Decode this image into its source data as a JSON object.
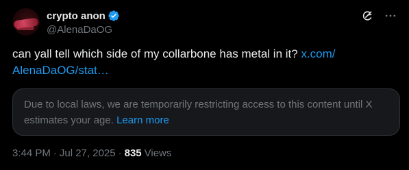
{
  "author": {
    "display_name": "crypto anon",
    "handle": "@AlenaDaOG",
    "verified": true
  },
  "post": {
    "text": "can yall tell which side of my collarbone has metal in it? ",
    "link_line1": "x.com/",
    "link_line2": "AlenaDaOG/stat…"
  },
  "notice": {
    "text": "Due to local laws, we are temporarily restricting access to this content until X estimates your age. ",
    "link": "Learn more"
  },
  "meta": {
    "time": "3:44 PM",
    "separator": "·",
    "date": "Jul 27, 2025",
    "views_count": "835",
    "views_label": "Views"
  },
  "icons": {
    "verified": "verified-badge-icon",
    "grok": "grok-icon",
    "more": "more-dots-icon"
  },
  "colors": {
    "background": "#000000",
    "text": "#e7e9ea",
    "muted": "#71767b",
    "accent": "#1d9bf0",
    "card_bg": "#16181c",
    "card_border": "#2f3336"
  }
}
